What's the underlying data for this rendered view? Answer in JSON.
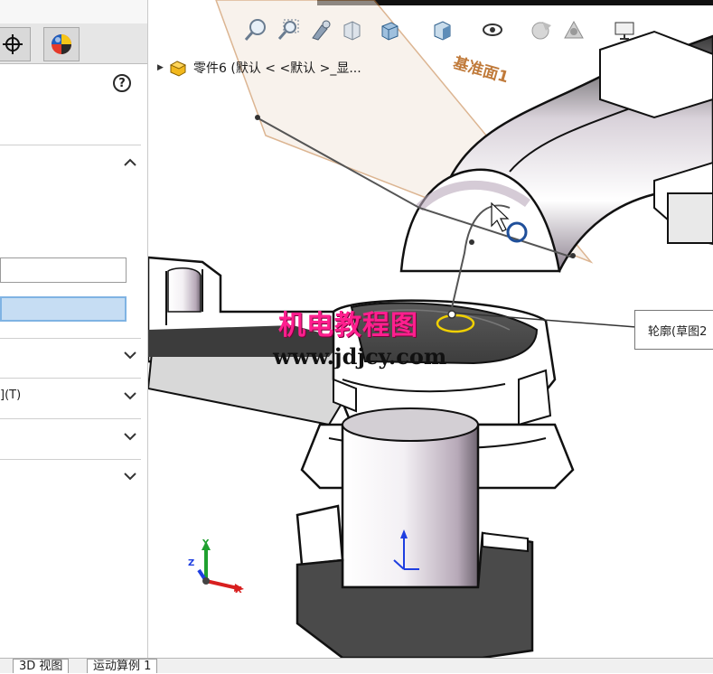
{
  "window": {
    "title": ""
  },
  "feature_tree": {
    "root_label": "零件6  (默认 < <默认 >_显..."
  },
  "watermark": {
    "chinese": "机电教程图",
    "url": "www.jdjcy.com"
  },
  "sketch_callout": {
    "label": "轮廓(草图2"
  },
  "plane": {
    "label": "基准面1"
  },
  "left_panel": {
    "help_glyph": "?",
    "row_label": "](T)",
    "field_value": "",
    "selected_field_value": ""
  },
  "bottom_tabs": [
    {
      "label": "3D 视图"
    },
    {
      "label": "运动算例 1"
    }
  ],
  "triad": {
    "x": "X",
    "y": "Y",
    "z": "Z"
  },
  "icons": {
    "target": "crosshair-icon",
    "appearance": "color-ball-icon",
    "zoom_fit": "zoom-to-fit-icon",
    "zoom_area": "zoom-area-icon",
    "previous_view": "previous-view-icon",
    "section": "section-view-icon",
    "view_orient": "view-orientation-icon",
    "display_style": "display-style-icon",
    "hide_show": "hide-show-icon",
    "edit_appearance": "edit-appearance-icon",
    "scene": "apply-scene-icon",
    "view_settings": "view-settings-icon"
  },
  "colors": {
    "accent_selection": "#c6ddf3",
    "plane": "#c07a3a",
    "watermark": "#ff1f8e",
    "cursor_ring": "#1f4f9a"
  }
}
